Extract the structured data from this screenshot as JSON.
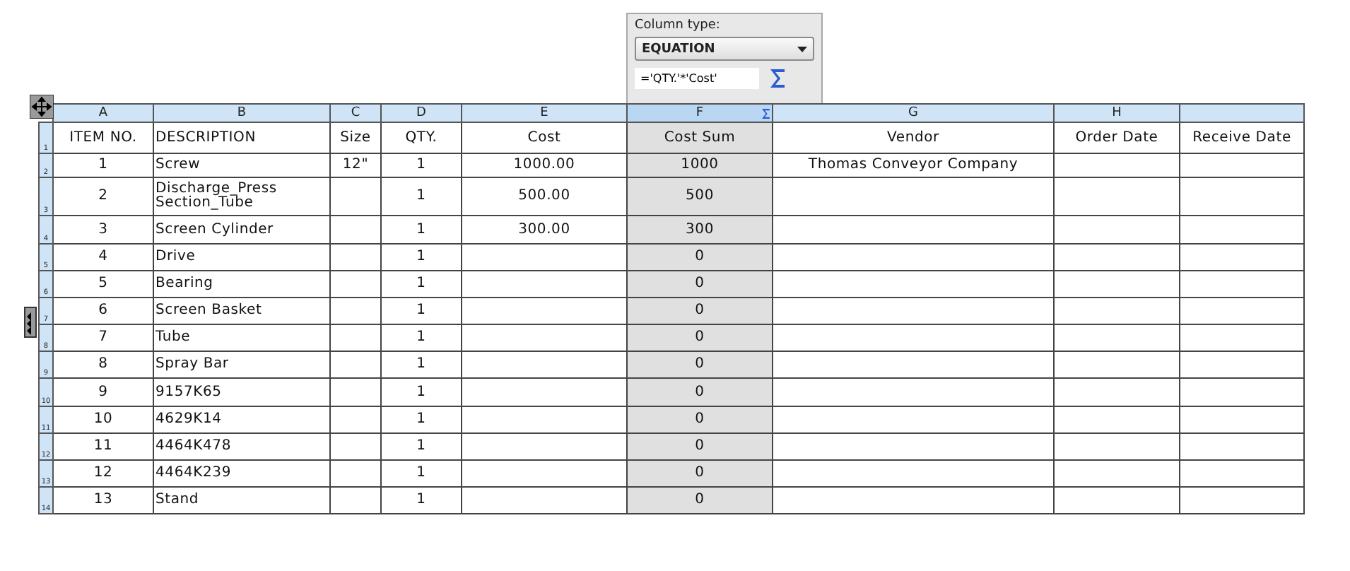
{
  "column_panel": {
    "label": "Column type:",
    "type_select": {
      "value": "EQUATION"
    },
    "equation_field": {
      "value": "='QTY.'*'Cost'"
    }
  },
  "table": {
    "columns": [
      {
        "letter": "A",
        "selected": false
      },
      {
        "letter": "B",
        "selected": false
      },
      {
        "letter": "C",
        "selected": false
      },
      {
        "letter": "D",
        "selected": false
      },
      {
        "letter": "E",
        "selected": false
      },
      {
        "letter": "F",
        "selected": true,
        "kind": "equation"
      },
      {
        "letter": "G",
        "selected": false
      },
      {
        "letter": "H",
        "selected": false
      },
      {
        "selected": false
      }
    ],
    "rows": [
      {
        "number": "1",
        "cells": [
          "ITEM NO.",
          "DESCRIPTION",
          "Size",
          "QTY.",
          "Cost",
          "Cost Sum",
          "Vendor",
          "Order Date",
          "Receive Date"
        ]
      },
      {
        "number": "2",
        "cells": [
          "1",
          "Screw",
          "12\"",
          "1",
          "1000.00",
          "1000",
          "Thomas Conveyor Company",
          "",
          ""
        ]
      },
      {
        "number": "3",
        "cells": [
          "2",
          "Discharge_Press Section_Tube",
          "",
          "1",
          "500.00",
          "500",
          "",
          "",
          ""
        ]
      },
      {
        "number": "4",
        "cells": [
          "3",
          "Screen Cylinder",
          "",
          "1",
          "300.00",
          "300",
          "",
          "",
          ""
        ]
      },
      {
        "number": "5",
        "cells": [
          "4",
          "Drive",
          "",
          "1",
          "",
          "0",
          "",
          "",
          ""
        ]
      },
      {
        "number": "6",
        "cells": [
          "5",
          "Bearing",
          "",
          "1",
          "",
          "0",
          "",
          "",
          ""
        ]
      },
      {
        "number": "7",
        "cells": [
          "6",
          "Screen Basket",
          "",
          "1",
          "",
          "0",
          "",
          "",
          ""
        ]
      },
      {
        "number": "8",
        "cells": [
          "7",
          "Tube",
          "",
          "1",
          "",
          "0",
          "",
          "",
          ""
        ]
      },
      {
        "number": "9",
        "cells": [
          "8",
          "Spray Bar",
          "",
          "1",
          "",
          "0",
          "",
          "",
          ""
        ]
      },
      {
        "number": "10",
        "cells": [
          "9",
          "9157K65",
          "",
          "1",
          "",
          "0",
          "",
          "",
          ""
        ]
      },
      {
        "number": "11",
        "cells": [
          "10",
          "4629K14",
          "",
          "1",
          "",
          "0",
          "",
          "",
          ""
        ]
      },
      {
        "number": "12",
        "cells": [
          "11",
          "4464K478",
          "",
          "1",
          "",
          "0",
          "",
          "",
          ""
        ]
      },
      {
        "number": "13",
        "cells": [
          "12",
          "4464K239",
          "",
          "1",
          "",
          "0",
          "",
          "",
          ""
        ]
      },
      {
        "number": "14",
        "cells": [
          "13",
          "Stand",
          "",
          "1",
          "",
          "0",
          "",
          "",
          ""
        ]
      }
    ]
  }
}
